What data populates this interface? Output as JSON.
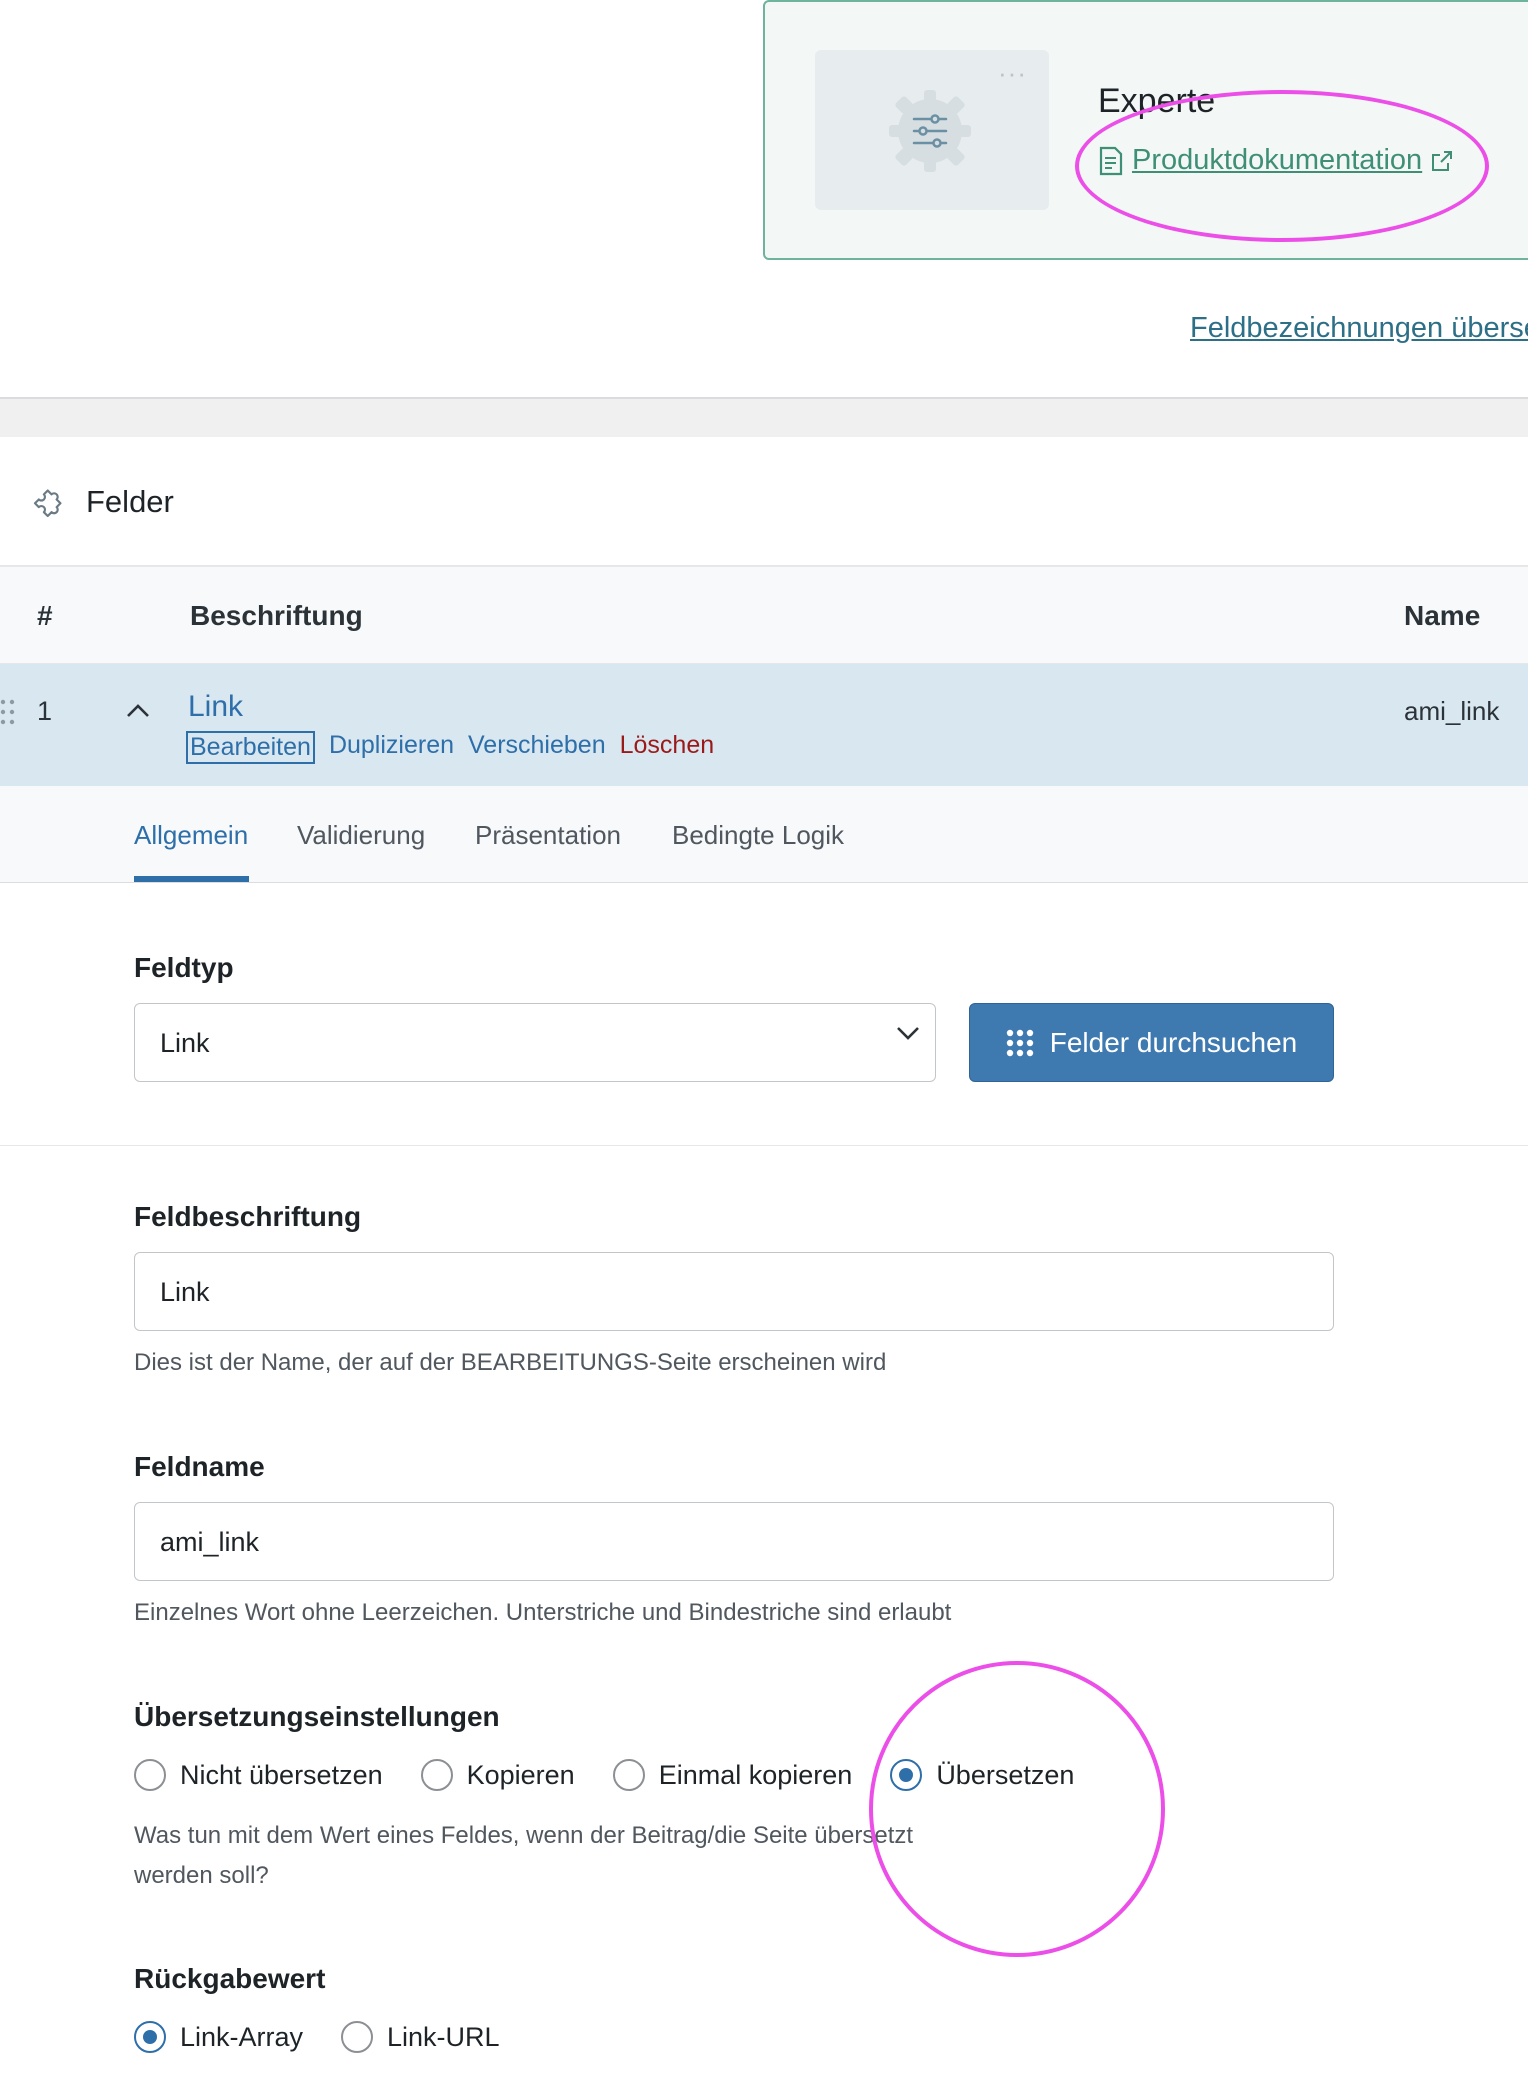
{
  "expert_card": {
    "title": "Experte",
    "doc_link": "Produktdokumentation",
    "thumb_dots": "···"
  },
  "top_link": "Feldbezeichnungen überse",
  "felder": {
    "title": "Felder",
    "columns": {
      "hash": "#",
      "label": "Beschriftung",
      "name": "Name"
    }
  },
  "field_row": {
    "number": "1",
    "label": "Link",
    "name": "ami_link",
    "actions": {
      "edit": "Bearbeiten",
      "duplicate": "Duplizieren",
      "move": "Verschieben",
      "delete": "Löschen"
    }
  },
  "tabs": [
    "Allgemein",
    "Validierung",
    "Präsentation",
    "Bedingte Logik"
  ],
  "form": {
    "field_type_label": "Feldtyp",
    "field_type_value": "Link",
    "browse_button": "Felder durchsuchen",
    "field_label_label": "Feldbeschriftung",
    "field_label_value": "Link",
    "field_label_help": "Dies ist der Name, der auf der BEARBEITUNGS-Seite erscheinen wird",
    "field_name_label": "Feldname",
    "field_name_value": "ami_link",
    "field_name_help": "Einzelnes Wort ohne Leerzeichen. Unterstriche und Bindestriche sind erlaubt",
    "translation_label": "Übersetzungseinstellungen",
    "translation_options": [
      "Nicht übersetzen",
      "Kopieren",
      "Einmal kopieren",
      "Übersetzen"
    ],
    "translation_selected": "Übersetzen",
    "translation_help_line1": "Was tun mit dem Wert eines Feldes, wenn der Beitrag/die Seite übersetzt",
    "translation_help_line2": "werden soll?",
    "return_label": "Rückgabewert",
    "return_options": [
      "Link-Array",
      "Link-URL"
    ],
    "return_selected": "Link-Array"
  },
  "colors": {
    "accent": "#2e6fa9",
    "link_green": "#3f8f76",
    "delete_red": "#9a1a1a",
    "highlight": "#ec4ee8",
    "row_bg": "#d8e7f0"
  }
}
